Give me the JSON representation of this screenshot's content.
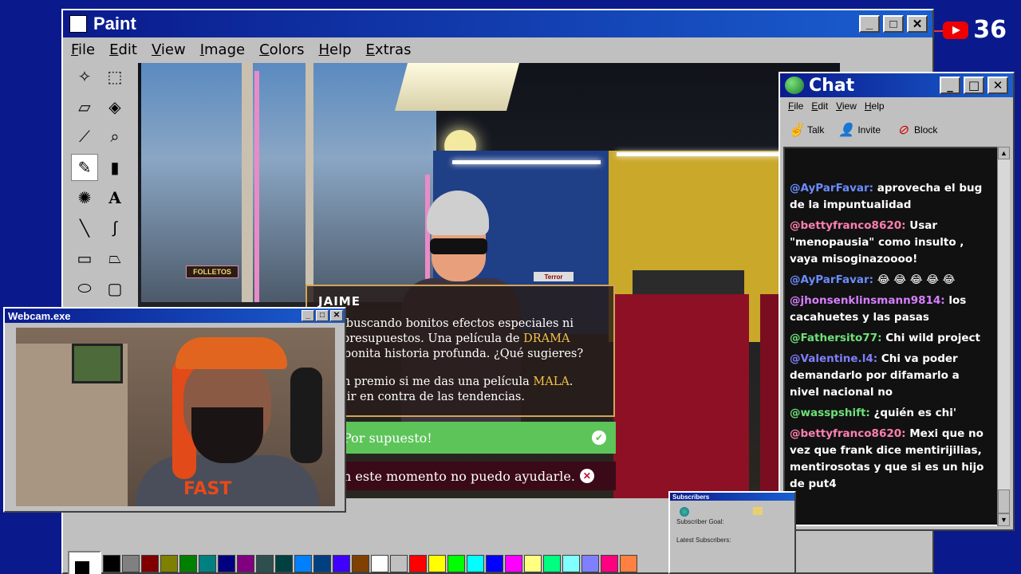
{
  "youtube": {
    "count": "36"
  },
  "paint": {
    "title": "Paint",
    "menu": [
      "File",
      "Edit",
      "View",
      "Image",
      "Colors",
      "Help",
      "Extras"
    ],
    "palette": [
      "#000000",
      "#808080",
      "#800000",
      "#808000",
      "#008000",
      "#008080",
      "#000080",
      "#800080",
      "#2f4f4f",
      "#004040",
      "#0080ff",
      "#004080",
      "#4000ff",
      "#804000",
      "#ffffff",
      "#c0c0c0",
      "#ff0000",
      "#ffff00",
      "#00ff00",
      "#00ffff",
      "#0000ff",
      "#ff00ff",
      "#ffff80",
      "#00ff80",
      "#80ffff",
      "#8080ff",
      "#ff0080",
      "#ff8040"
    ]
  },
  "game": {
    "sign_folletos": "FOLLETOS",
    "sign_terror": "Terror",
    "dialog_name": "JAIME",
    "dialog_line1_a": "stoy buscando bonitos efectos especiales ni",
    "dialog_line2_a": "des presupuestos. Una película de ",
    "dialog_line2_hl": "DRAMA",
    "dialog_line3": "una bonita historia profunda. ¿Qué sugieres?",
    "dialog_line4_a": "oy un premio si me das una película ",
    "dialog_line4_hl": "MALA",
    "dialog_line4_b": ".",
    "dialog_line5": "usta ir en contra de las tendencias.",
    "option_yes": "Por supuesto!",
    "option_no": "n este momento no puedo ayudarle."
  },
  "chat": {
    "title": "Chat",
    "menu": [
      "File",
      "Edit",
      "View",
      "Help"
    ],
    "tools": [
      "Talk",
      "Invite",
      "Block"
    ],
    "messages": [
      {
        "user": "@AyParFavar:",
        "text": "aprovecha el bug de la impuntualidad",
        "color": "#6b8cff"
      },
      {
        "user": "@bettyfranco8620:",
        "text": "Usar \"menopausia\" como insulto , vaya misoginazoooo!",
        "color": "#ff7fb0"
      },
      {
        "user": "@AyParFavar:",
        "text": "😂 😂 😂 😂 😂",
        "color": "#6b8cff"
      },
      {
        "user": "@jhonsenklinsmann9814:",
        "text": "los cacahuetes y las pasas",
        "color": "#d77fff"
      },
      {
        "user": "@Fathersito77:",
        "text": "Chi wild project",
        "color": "#6fe07a"
      },
      {
        "user": "@Valentine.l4:",
        "text": "Chi va poder demandarlo por difamarlo a nivel nacional no",
        "color": "#7f7fff"
      },
      {
        "user": "@wasspshift:",
        "text": "¿quién es chi'",
        "color": "#6fe07a"
      },
      {
        "user": "@bettyfranco8620:",
        "text": "Mexi que no vez que frank dice mentirijilias, mentirosotas y que si es un hijo de put4",
        "color": "#ff7fb0"
      }
    ]
  },
  "webcam": {
    "title": "Webcam.exe",
    "shirt_text": "FAST"
  },
  "subscribers": {
    "title": "Subscribers",
    "goal_label": "Subscriber Goal:",
    "latest_label": "Latest Subscribers:"
  }
}
